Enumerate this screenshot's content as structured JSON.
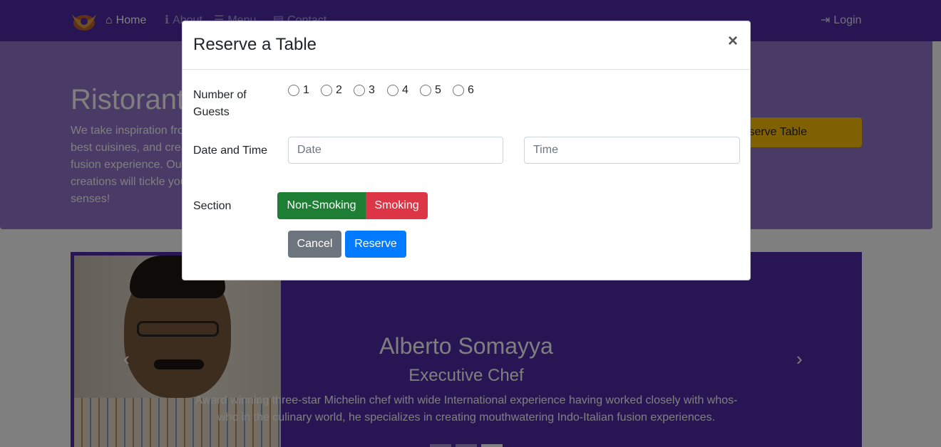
{
  "navbar": {
    "home": "Home",
    "about": "About",
    "menu": "Menu",
    "contact": "Contact",
    "login": "Login",
    "icons": {
      "home": "home-icon",
      "about": "info-icon",
      "menu": "list-icon",
      "contact": "address-card-icon",
      "login": "sign-in-icon"
    }
  },
  "jumbotron": {
    "title": "Ristorante con Fusion",
    "text": "We take inspiration from the World's best cuisines, and create a unique fusion experience. Our lipsmacking creations will tickle your culinary senses!",
    "reserve_button": "Reserve Table"
  },
  "carousel": {
    "name": "Alberto Somayya",
    "role": "Executive Chef",
    "description": "Award winning three-star Michelin chef with wide International experience having worked closely with whos-who in the culinary world, he specializes in creating mouthwatering Indo-Italian fusion experiences.",
    "prev_glyph": "‹",
    "next_glyph": "›"
  },
  "modal": {
    "title": "Reserve a Table",
    "close": "×",
    "guests_label": "Number of Guests",
    "guest_options": [
      "1",
      "2",
      "3",
      "4",
      "5",
      "6"
    ],
    "date_time_label": "Date and Time",
    "date_placeholder": "Date",
    "time_placeholder": "Time",
    "section_label": "Section",
    "non_smoking": "Non-Smoking",
    "smoking": "Smoking",
    "cancel": "Cancel",
    "reserve": "Reserve"
  },
  "colors": {
    "navbar": "#512da8",
    "jumbotron": "#9575cd",
    "warning": "#ffc107",
    "success": "#1e7e34",
    "danger": "#dc3545",
    "primary": "#007bff",
    "secondary": "#6c757d"
  }
}
